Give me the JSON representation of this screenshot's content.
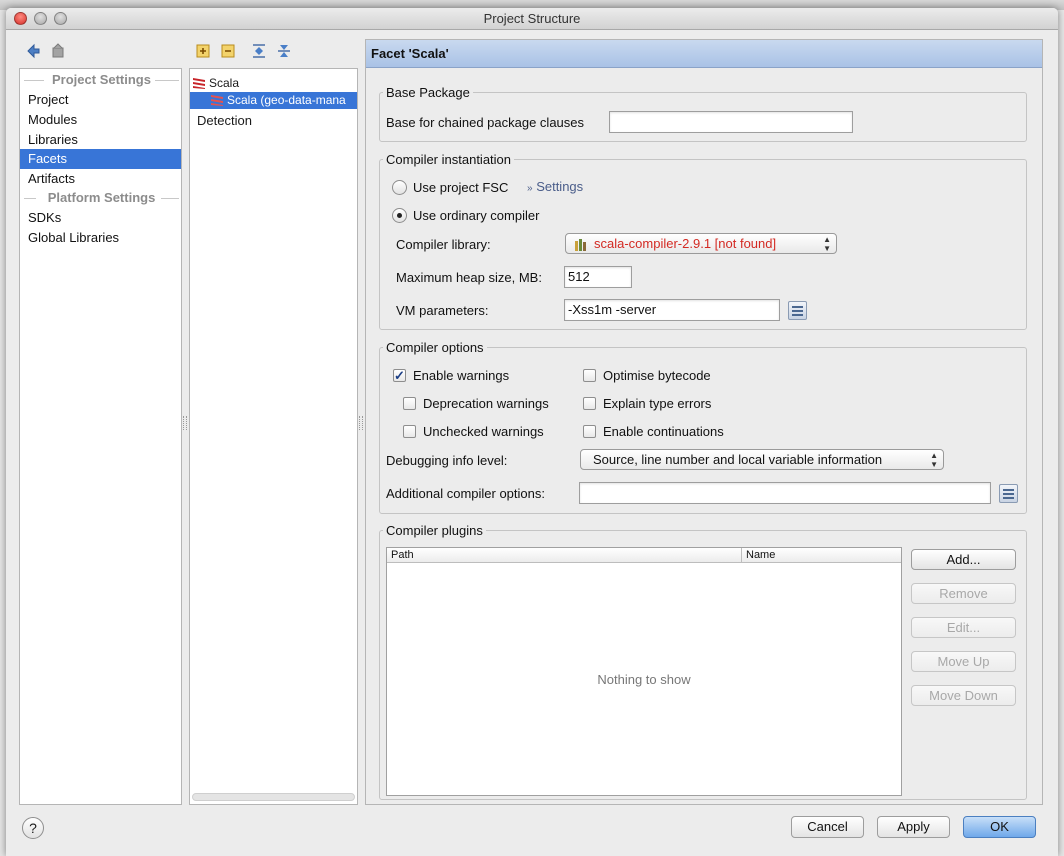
{
  "window": {
    "title": "Project Structure"
  },
  "nav": {
    "project_settings_header": "Project Settings",
    "project_settings": [
      "Project",
      "Modules",
      "Libraries",
      "Facets",
      "Artifacts"
    ],
    "selected": "Facets",
    "platform_settings_header": "Platform Settings",
    "platform_settings": [
      "SDKs",
      "Global Libraries"
    ]
  },
  "tree": {
    "root": "Scala",
    "child": "Scala (geo-data-mana",
    "detection": "Detection"
  },
  "facet": {
    "header": "Facet 'Scala'"
  },
  "base_package": {
    "title": "Base Package",
    "label": "Base for chained package clauses",
    "value": ""
  },
  "compiler_instantiation": {
    "title": "Compiler instantiation",
    "use_fsc_label": "Use project FSC",
    "settings_link": "Settings",
    "use_ordinary_label": "Use ordinary compiler",
    "selected_mode": "Use ordinary compiler",
    "library_label": "Compiler library:",
    "library_value": "scala-compiler-2.9.1 [not found]",
    "heap_label": "Maximum heap size, MB:",
    "heap_value": "512",
    "vm_label": "VM parameters:",
    "vm_value": "-Xss1m -server"
  },
  "compiler_options": {
    "title": "Compiler options",
    "enable_warnings": "Enable warnings",
    "deprecation_warnings": "Deprecation warnings",
    "unchecked_warnings": "Unchecked warnings",
    "optimise_bytecode": "Optimise bytecode",
    "explain_type_errors": "Explain type errors",
    "enable_continuations": "Enable continuations",
    "checked": [
      "Enable warnings"
    ],
    "debug_label": "Debugging info level:",
    "debug_value": "Source, line number and local variable information",
    "additional_label": "Additional compiler options:",
    "additional_value": ""
  },
  "compiler_plugins": {
    "title": "Compiler plugins",
    "columns": [
      "Path",
      "Name"
    ],
    "empty_text": "Nothing to show",
    "buttons": {
      "add": "Add...",
      "remove": "Remove",
      "edit": "Edit...",
      "move_up": "Move Up",
      "move_down": "Move Down"
    }
  },
  "footer": {
    "help": "?",
    "cancel": "Cancel",
    "apply": "Apply",
    "ok": "OK"
  },
  "colors": {
    "selection": "#3875d7",
    "header_blue": "#b9cdec",
    "error_red": "#d32a23",
    "link": "#4a5d8a"
  }
}
